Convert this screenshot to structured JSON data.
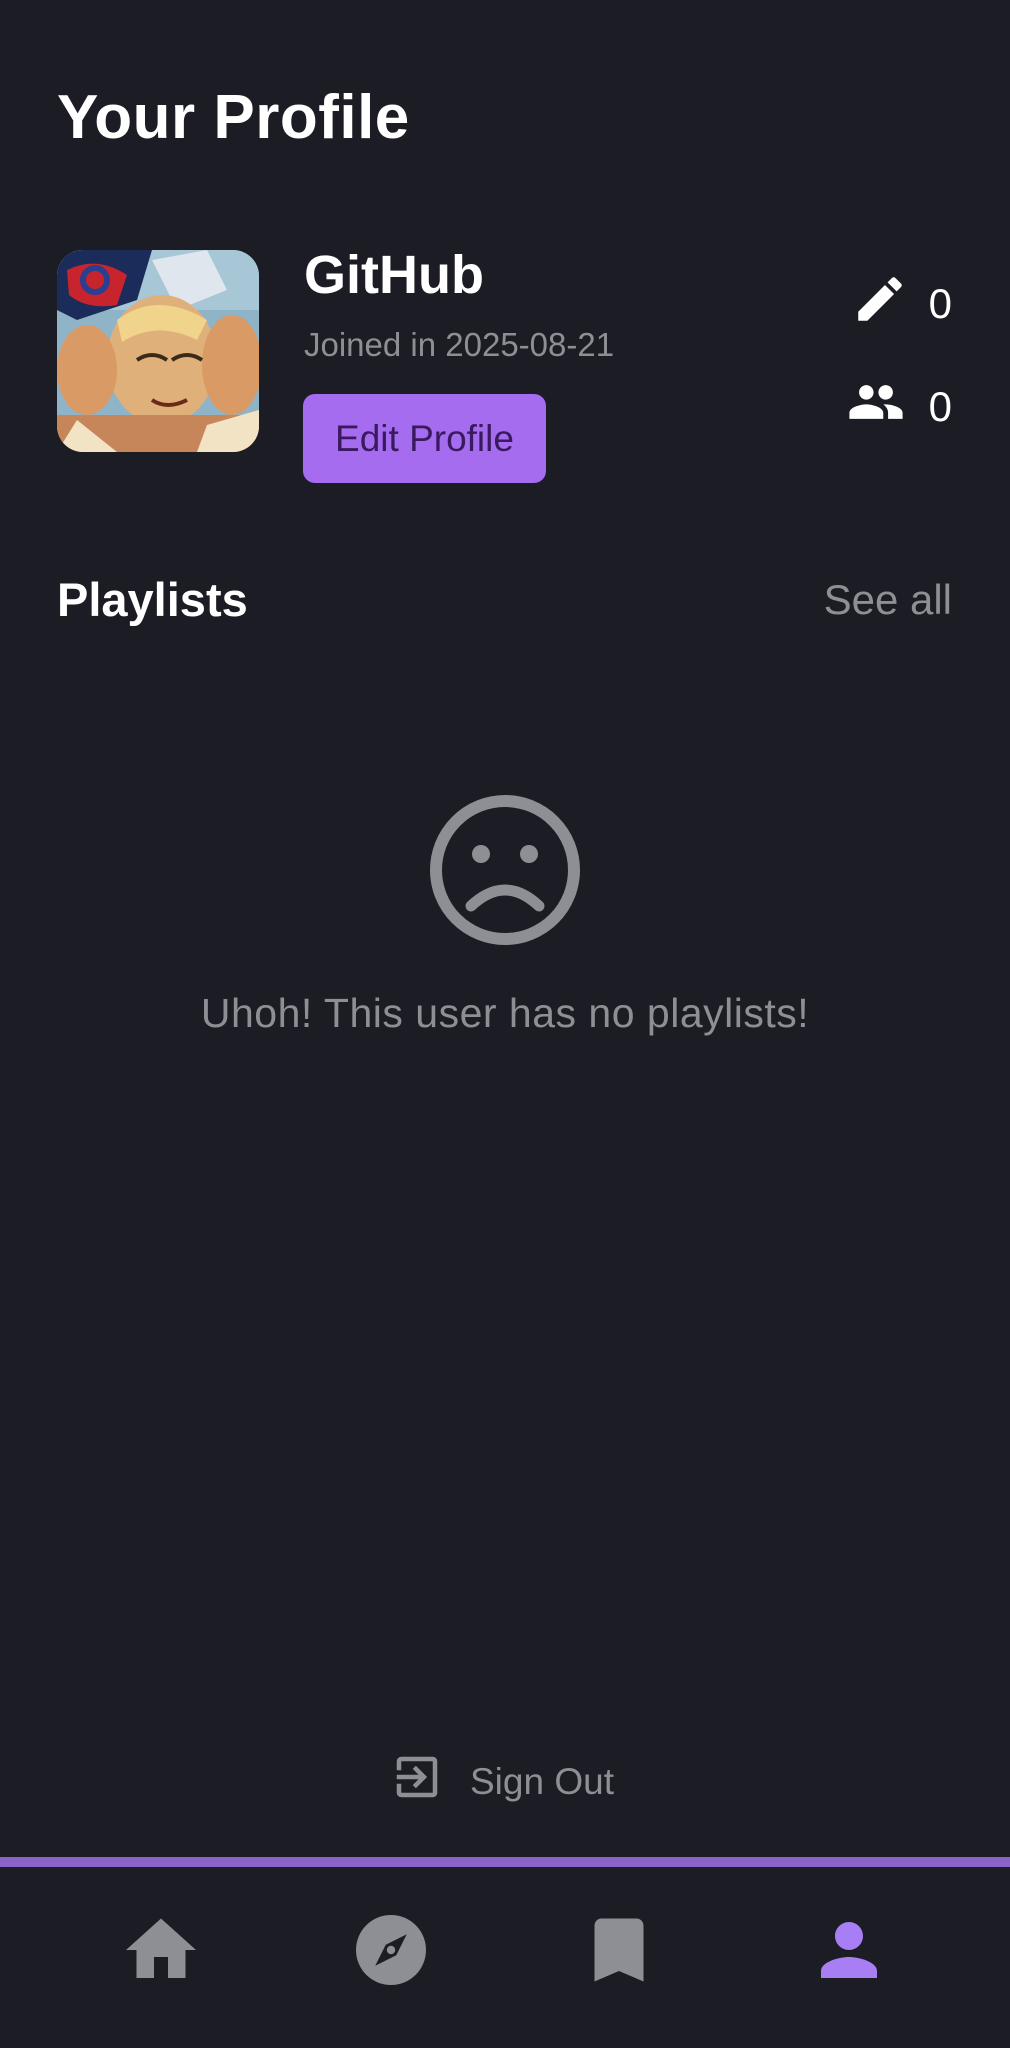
{
  "header": {
    "title": "Your Profile"
  },
  "profile": {
    "username": "GitHub",
    "joined": "Joined in 2025-08-21",
    "edit_label": "Edit Profile",
    "posts_count": "0",
    "followers_count": "0"
  },
  "playlists": {
    "title": "Playlists",
    "see_all": "See all",
    "empty_message": "Uhoh! This user has no playlists!",
    "empty_icon": "sad-face-icon"
  },
  "signout": {
    "label": "Sign Out",
    "icon": "exit-icon"
  },
  "nav": {
    "items": [
      {
        "icon": "home-icon",
        "active": false
      },
      {
        "icon": "compass-icon",
        "active": false
      },
      {
        "icon": "bookmark-icon",
        "active": false
      },
      {
        "icon": "person-icon",
        "active": true
      }
    ]
  },
  "colors": {
    "background": "#1c1d24",
    "accent": "#a56cf0",
    "muted": "#8d8f95",
    "active_nav": "#a87ef5"
  }
}
